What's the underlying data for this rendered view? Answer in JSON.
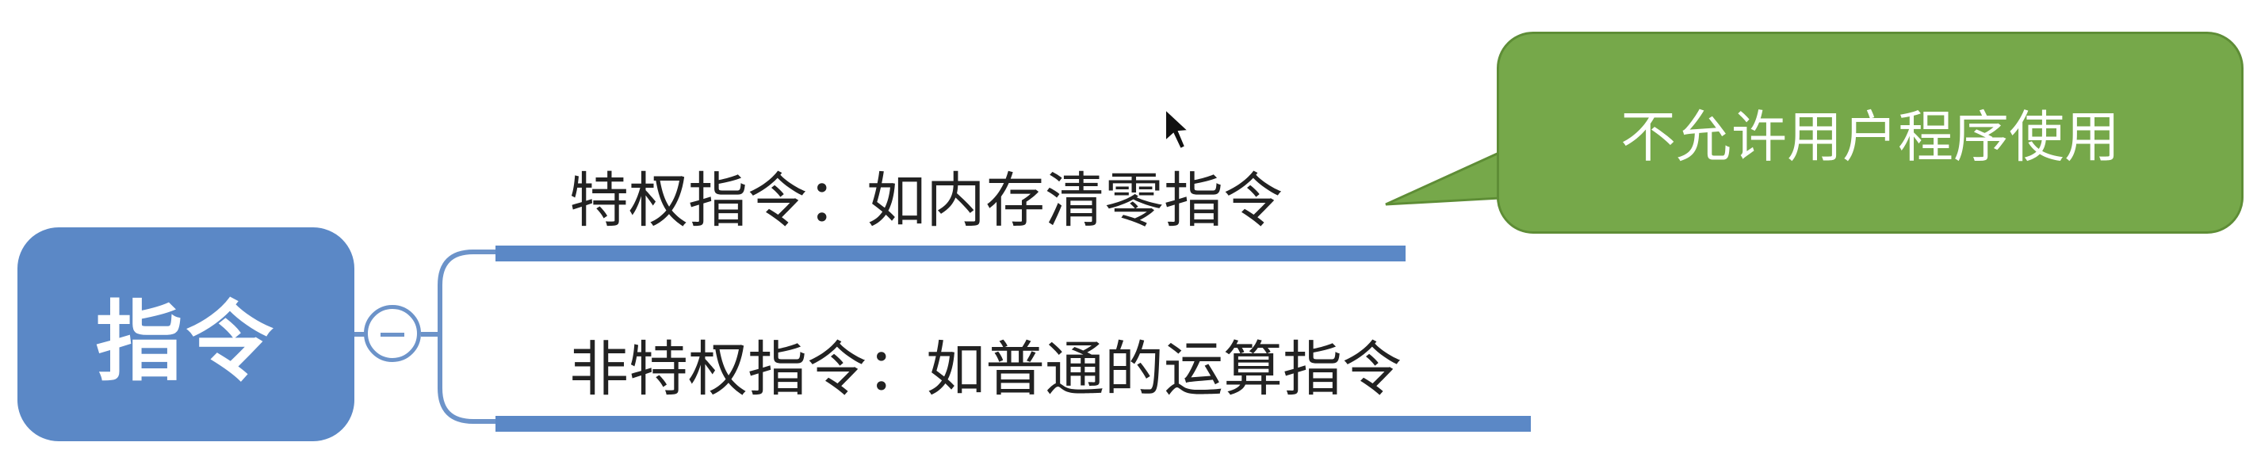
{
  "mindmap": {
    "root": {
      "label": "指令",
      "color": "#5b88c6",
      "toggle_icon": "minus-circle"
    },
    "branches": [
      {
        "label": "特权指令：如内存清零指令",
        "line_color": "#5b88c6",
        "callout": {
          "text": "不允许用户程序使用",
          "color": "#76a84a"
        }
      },
      {
        "label": "非特权指令：如普通的运算指令",
        "line_color": "#5b88c6"
      }
    ]
  },
  "cursor_icon": "arrow-pointer"
}
